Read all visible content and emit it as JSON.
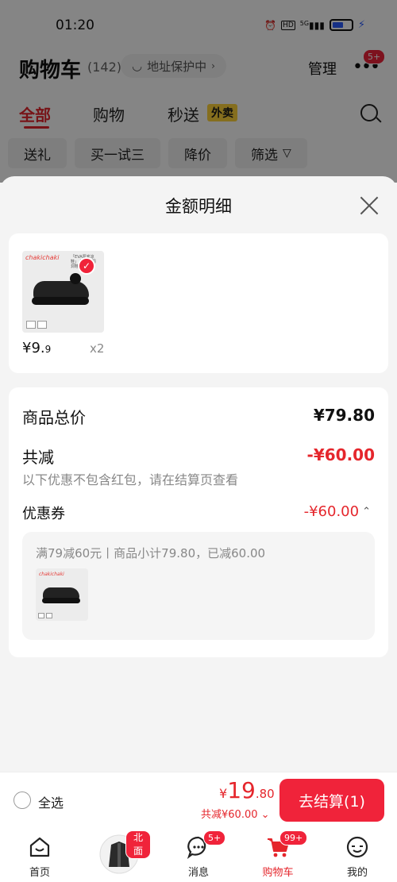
{
  "status": {
    "time": "01:20",
    "icons": [
      "alarm-icon",
      "hd-icon",
      "5g-signal-icon",
      "battery-icon",
      "charging-icon"
    ],
    "hd": "HD",
    "net": "5G"
  },
  "header": {
    "title": "购物车",
    "count": "(142)",
    "address": "地址保护中",
    "manage": "管理",
    "more_badge": "5+"
  },
  "tabs": [
    {
      "label": "全部"
    },
    {
      "label": "购物"
    },
    {
      "label": "秒送"
    }
  ],
  "takeout_tag": "外卖",
  "chips": [
    {
      "label": "送礼"
    },
    {
      "label": "买一试三"
    },
    {
      "label": "降价"
    },
    {
      "label": "筛选"
    }
  ],
  "sheet": {
    "title": "金额明细",
    "item": {
      "price_int": "¥9.",
      "price_dec": "9",
      "qty": "x2",
      "brand": "chakichaki",
      "thumb_text": "「EVA厚底凉鞋」 百搭款洞洞鞋"
    },
    "summary": {
      "total_label": "商品总价",
      "total_value": "¥79.80",
      "reduce_label": "共减",
      "reduce_value": "-¥60.00",
      "reduce_note": "以下优惠不包含红包，请在结算页查看",
      "coupon_label": "优惠券",
      "coupon_value": "-¥60.00",
      "coupon_desc": "满79减60元丨商品小计79.80，已减60.00"
    }
  },
  "checkout": {
    "select_all": "全选",
    "yen": "¥",
    "total_int": "19",
    "total_dec": ".80",
    "discount": "共减¥60.00",
    "pay_label": "去结算(1)"
  },
  "nav": [
    {
      "label": "首页"
    },
    {
      "label": "",
      "badge": "北面"
    },
    {
      "label": "消息",
      "badge": "5+"
    },
    {
      "label": "购物车",
      "badge": "99+"
    },
    {
      "label": "我的"
    }
  ],
  "colors": {
    "accent": "#e5262c",
    "button": "#f0233a",
    "takeout": "#ffd43b"
  }
}
